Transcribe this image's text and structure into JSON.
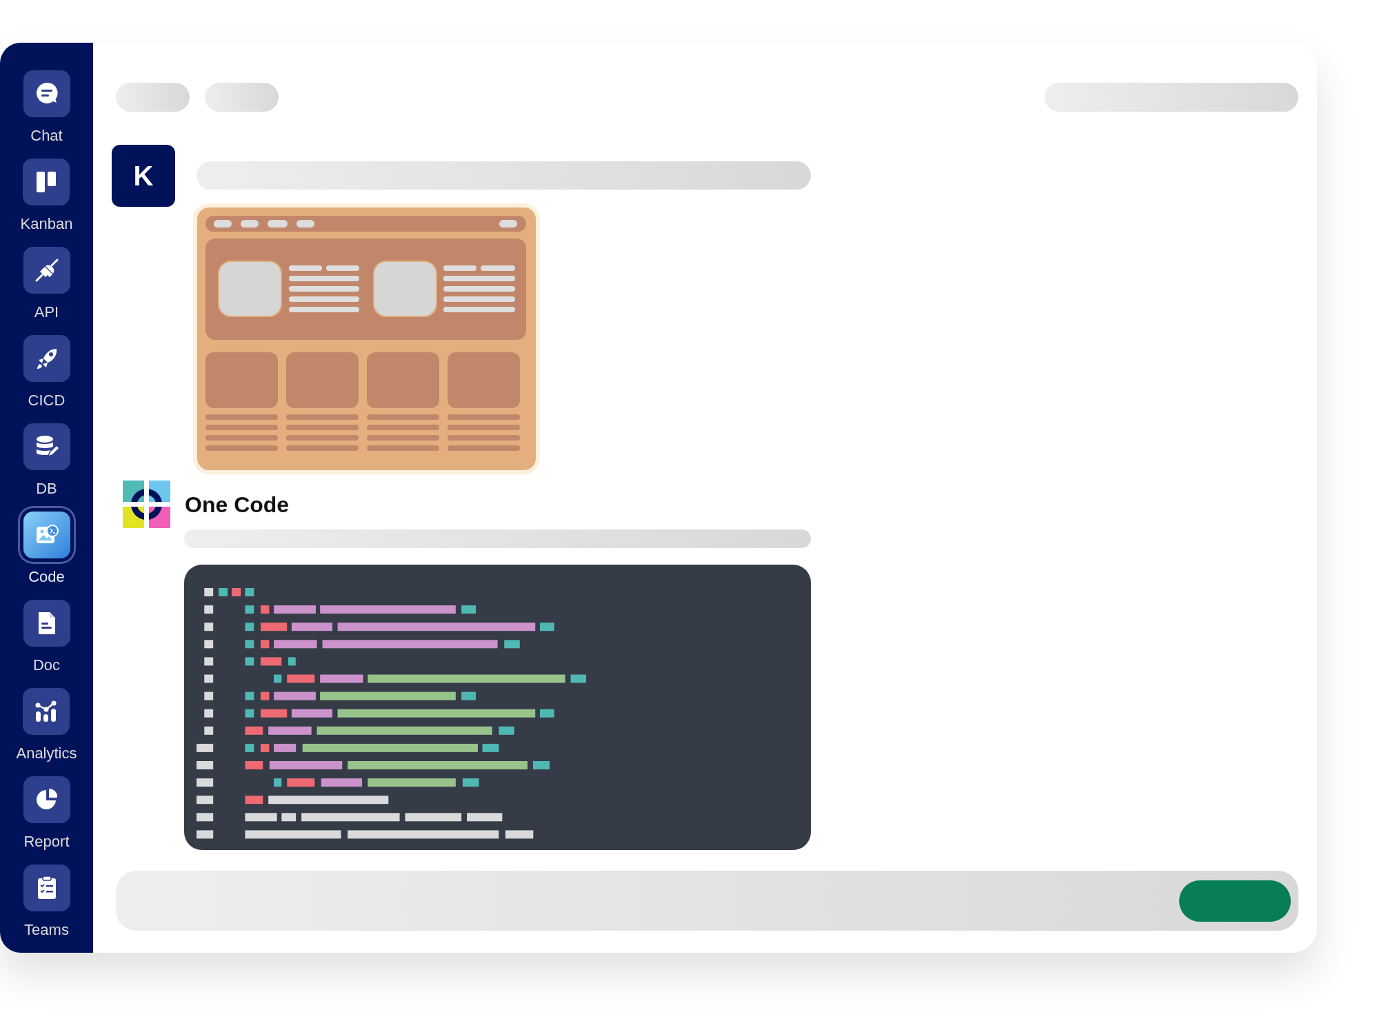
{
  "sidebar": {
    "items": [
      {
        "label": "Chat",
        "selected": false
      },
      {
        "label": "Kanban",
        "selected": false
      },
      {
        "label": "API",
        "selected": false
      },
      {
        "label": "CICD",
        "selected": false
      },
      {
        "label": "DB",
        "selected": false
      },
      {
        "label": "Code",
        "selected": true
      },
      {
        "label": "Doc",
        "selected": false
      },
      {
        "label": "Analytics",
        "selected": false
      },
      {
        "label": "Report",
        "selected": false
      },
      {
        "label": "Teams",
        "selected": false
      }
    ]
  },
  "user_message": {
    "avatar_initial": "K"
  },
  "bot_message": {
    "name": "One Code"
  }
}
